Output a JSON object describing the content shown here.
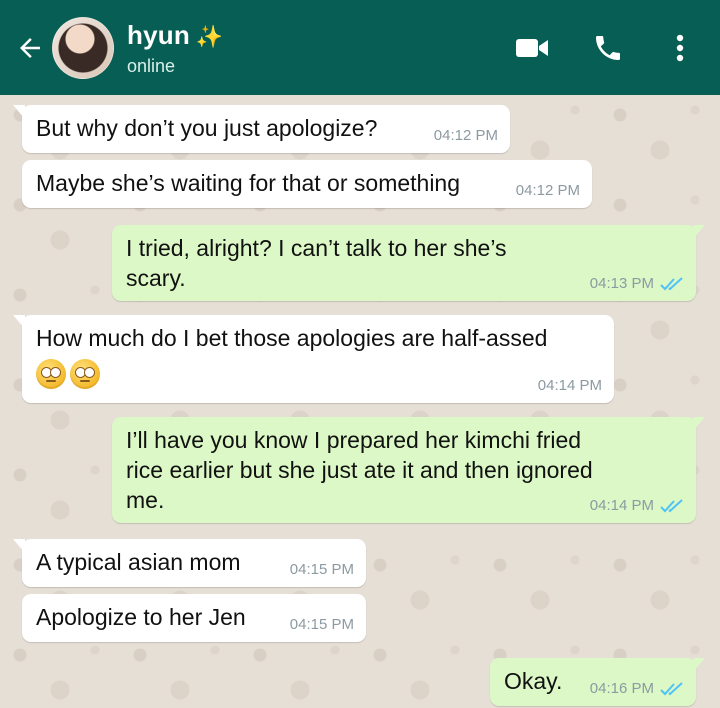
{
  "header": {
    "contact_name": "hyun",
    "sparkle": "✨",
    "status": "online"
  },
  "colors": {
    "header_bg": "#075e54",
    "incoming_bubble": "#ffffff",
    "outgoing_bubble": "#dcf8c6",
    "read_ticks": "#4fc3f7",
    "wallpaper": "#e6dfd6"
  },
  "icons": {
    "back": "back-arrow-icon",
    "video": "video-camera-icon",
    "call": "phone-icon",
    "menu": "more-vertical-icon",
    "read": "double-check-icon",
    "emoji": "face-with-rolling-eyes-icon"
  },
  "messages": [
    {
      "direction": "in",
      "text": "But why don’t you just apologize?",
      "time": "04:12 PM"
    },
    {
      "direction": "in",
      "text": "Maybe she’s waiting for that or something",
      "time": "04:12 PM"
    },
    {
      "direction": "out",
      "line1": "I tried, alright? I can’t talk to her she’s",
      "line2": "scary.",
      "time": "04:13 PM",
      "read": true
    },
    {
      "direction": "in",
      "line1": "How much do I bet those apologies are half-assed",
      "emoji": "🙄🙄",
      "time": "04:14 PM"
    },
    {
      "direction": "out",
      "line1": "I’ll have you know I prepared her kimchi fried",
      "line2": "rice earlier but she just ate it and then ignored",
      "line3": "me.",
      "time": "04:14 PM",
      "read": true
    },
    {
      "direction": "in",
      "text": "A typical asian mom",
      "time": "04:15 PM"
    },
    {
      "direction": "in",
      "text": "Apologize to her Jen",
      "time": "04:15 PM"
    },
    {
      "direction": "out",
      "text": "Okay.",
      "time": "04:16 PM",
      "read": true
    }
  ]
}
